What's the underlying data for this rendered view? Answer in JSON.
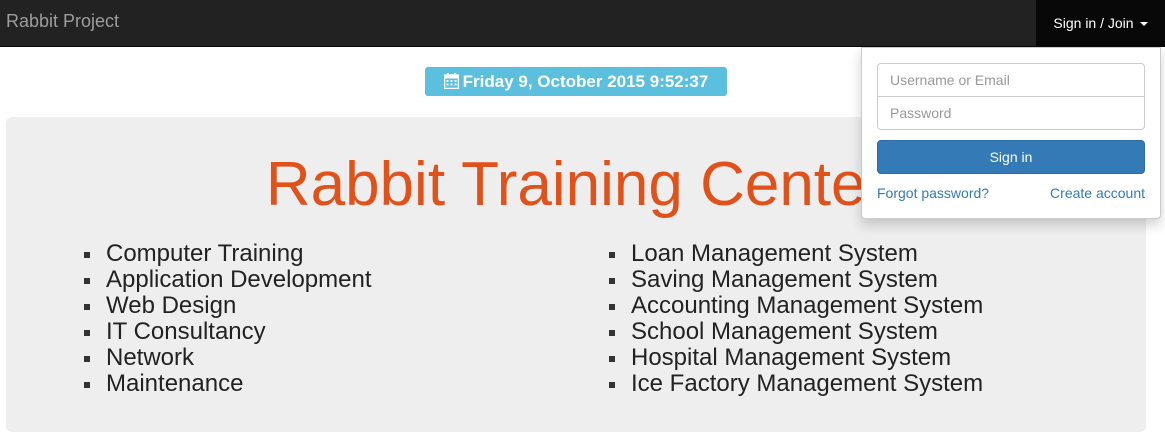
{
  "navbar": {
    "brand": "Rabbit Project",
    "signin_toggle": "Sign in / Join"
  },
  "date_label": {
    "icon": "calendar-icon",
    "text": "Friday 9, October 2015 9:52:37"
  },
  "jumbotron": {
    "title": "Rabbit Training Center",
    "title_color": "#e0521a",
    "left_list": [
      "Computer Training",
      "Application Development",
      "Web Design",
      "IT Consultancy",
      "Network",
      "Maintenance"
    ],
    "right_list": [
      "Loan Management System",
      "Saving Management System",
      "Accounting Management System",
      "School Management System",
      "Hospital Management System",
      "Ice Factory Management System"
    ]
  },
  "login_dropdown": {
    "username_placeholder": "Username or Email",
    "password_placeholder": "Password",
    "signin_label": "Sign in",
    "forgot_label": "Forgot password?",
    "create_label": "Create account"
  },
  "colors": {
    "navbar_bg": "#222222",
    "date_label_bg": "#5bc0de",
    "primary_button": "#337ab7",
    "jumbotron_bg": "#eeeeee"
  }
}
